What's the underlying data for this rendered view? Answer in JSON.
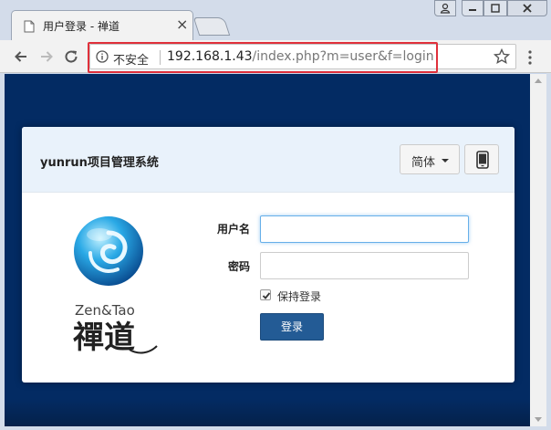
{
  "browser": {
    "tab_title": "用户登录 - 禅道",
    "tab_close": "×",
    "security_label": "不安全",
    "url_host": "192.168.1.43",
    "url_path": "/index.php?m=user&f=login",
    "accent_highlight": "#e0303b"
  },
  "header": {
    "title": "yunrun项目管理系统",
    "language_label": "简体"
  },
  "logo": {
    "brand_text": "Zen&Tao",
    "wordmark": "禪道"
  },
  "form": {
    "username_label": "用户名",
    "username_value": "",
    "password_label": "密码",
    "password_value": "",
    "remember_label": "保持登录",
    "remember_checked": true,
    "submit_label": "登录"
  },
  "colors": {
    "page_background": "#032b63",
    "header_background": "#e9f2fb",
    "primary_button": "#235b95"
  }
}
